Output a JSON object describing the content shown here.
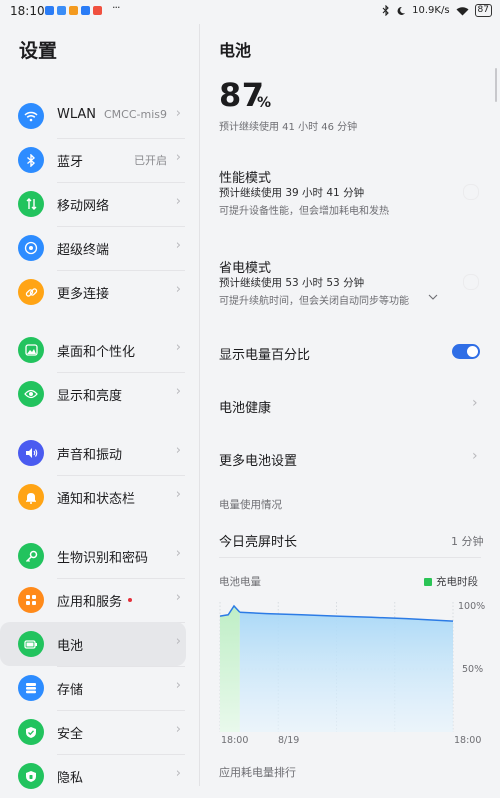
{
  "status_bar": {
    "time": "18:10",
    "net_speed": "10.9K/s",
    "battery": "87",
    "more": "···"
  },
  "settings_panel": {
    "title": "设置",
    "items": [
      {
        "label": "WLAN",
        "value": "CMCC-mis9",
        "icon": "wifi-icon",
        "color": "#2d8cff"
      },
      {
        "label": "蓝牙",
        "value": "已开启",
        "icon": "bluetooth-icon",
        "color": "#2d8cff"
      },
      {
        "label": "移动网络",
        "value": "",
        "icon": "mobile-data-icon",
        "color": "#22c35e"
      },
      {
        "label": "超级终端",
        "value": "",
        "icon": "super-device-icon",
        "color": "#2d8cff"
      },
      {
        "label": "更多连接",
        "value": "",
        "icon": "link-icon",
        "color": "#ffa415"
      },
      {
        "label": "桌面和个性化",
        "value": "",
        "icon": "wallpaper-icon",
        "color": "#22c35e"
      },
      {
        "label": "显示和亮度",
        "value": "",
        "icon": "eye-icon",
        "color": "#22c35e"
      },
      {
        "label": "声音和振动",
        "value": "",
        "icon": "volume-icon",
        "color": "#4a5bf0"
      },
      {
        "label": "通知和状态栏",
        "value": "",
        "icon": "bell-icon",
        "color": "#ffa415"
      },
      {
        "label": "生物识别和密码",
        "value": "",
        "icon": "key-icon",
        "color": "#22c35e"
      },
      {
        "label": "应用和服务",
        "value": "",
        "icon": "apps-icon",
        "color": "#ff8a1a"
      },
      {
        "label": "电池",
        "value": "",
        "icon": "battery-icon",
        "color": "#22c35e"
      },
      {
        "label": "存储",
        "value": "",
        "icon": "storage-icon",
        "color": "#2d8cff"
      },
      {
        "label": "安全",
        "value": "",
        "icon": "shield-icon",
        "color": "#22c35e"
      },
      {
        "label": "隐私",
        "value": "",
        "icon": "privacy-icon",
        "color": "#22c35e"
      }
    ]
  },
  "battery_page": {
    "title": "电池",
    "percent": "87",
    "percent_unit": "%",
    "remaining": "预计继续使用 41 小时 46 分钟",
    "performance_mode": {
      "title": "性能模式",
      "estimate": "预计继续使用 39 小时 41 分钟",
      "desc": "可提升设备性能，但会增加耗电和发热"
    },
    "power_saving_mode": {
      "title": "省电模式",
      "estimate": "预计继续使用 53 小时 53 分钟",
      "desc": "可提升续航时间，但会关闭自动同步等功能"
    },
    "show_percentage": {
      "label": "显示电量百分比",
      "on": true
    },
    "battery_health": "电池健康",
    "more_settings": "更多电池设置",
    "usage_section": "电量使用情况",
    "screen_on_today": {
      "label": "今日亮屏时长",
      "value": "1 分钟"
    },
    "chart_title": "电池电量",
    "legend": "充电时段",
    "app_ranking": "应用耗电量排行"
  },
  "chart_data": {
    "type": "area",
    "title": "电池电量",
    "x_ticks": [
      "18:00",
      "8/19",
      "18:00"
    ],
    "y_ticks": [
      "100%",
      "50%"
    ],
    "ylim": [
      0,
      100
    ],
    "series": [
      {
        "name": "充电时段",
        "points": [
          [
            0,
            92
          ],
          [
            0.035,
            93
          ],
          [
            0.06,
            100
          ],
          [
            0.085,
            95
          ]
        ]
      },
      {
        "name": "",
        "points": [
          [
            0.085,
            95
          ],
          [
            0.2,
            94
          ],
          [
            0.35,
            93
          ],
          [
            0.5,
            92
          ],
          [
            0.65,
            91
          ],
          [
            0.8,
            90
          ],
          [
            0.9,
            89
          ],
          [
            1.0,
            88
          ]
        ]
      }
    ],
    "colors": {
      "line": "#2c7be5",
      "fill": "#bfe2fb",
      "charging_fill": "#c9f0cf",
      "legend": "#2bc456"
    }
  }
}
